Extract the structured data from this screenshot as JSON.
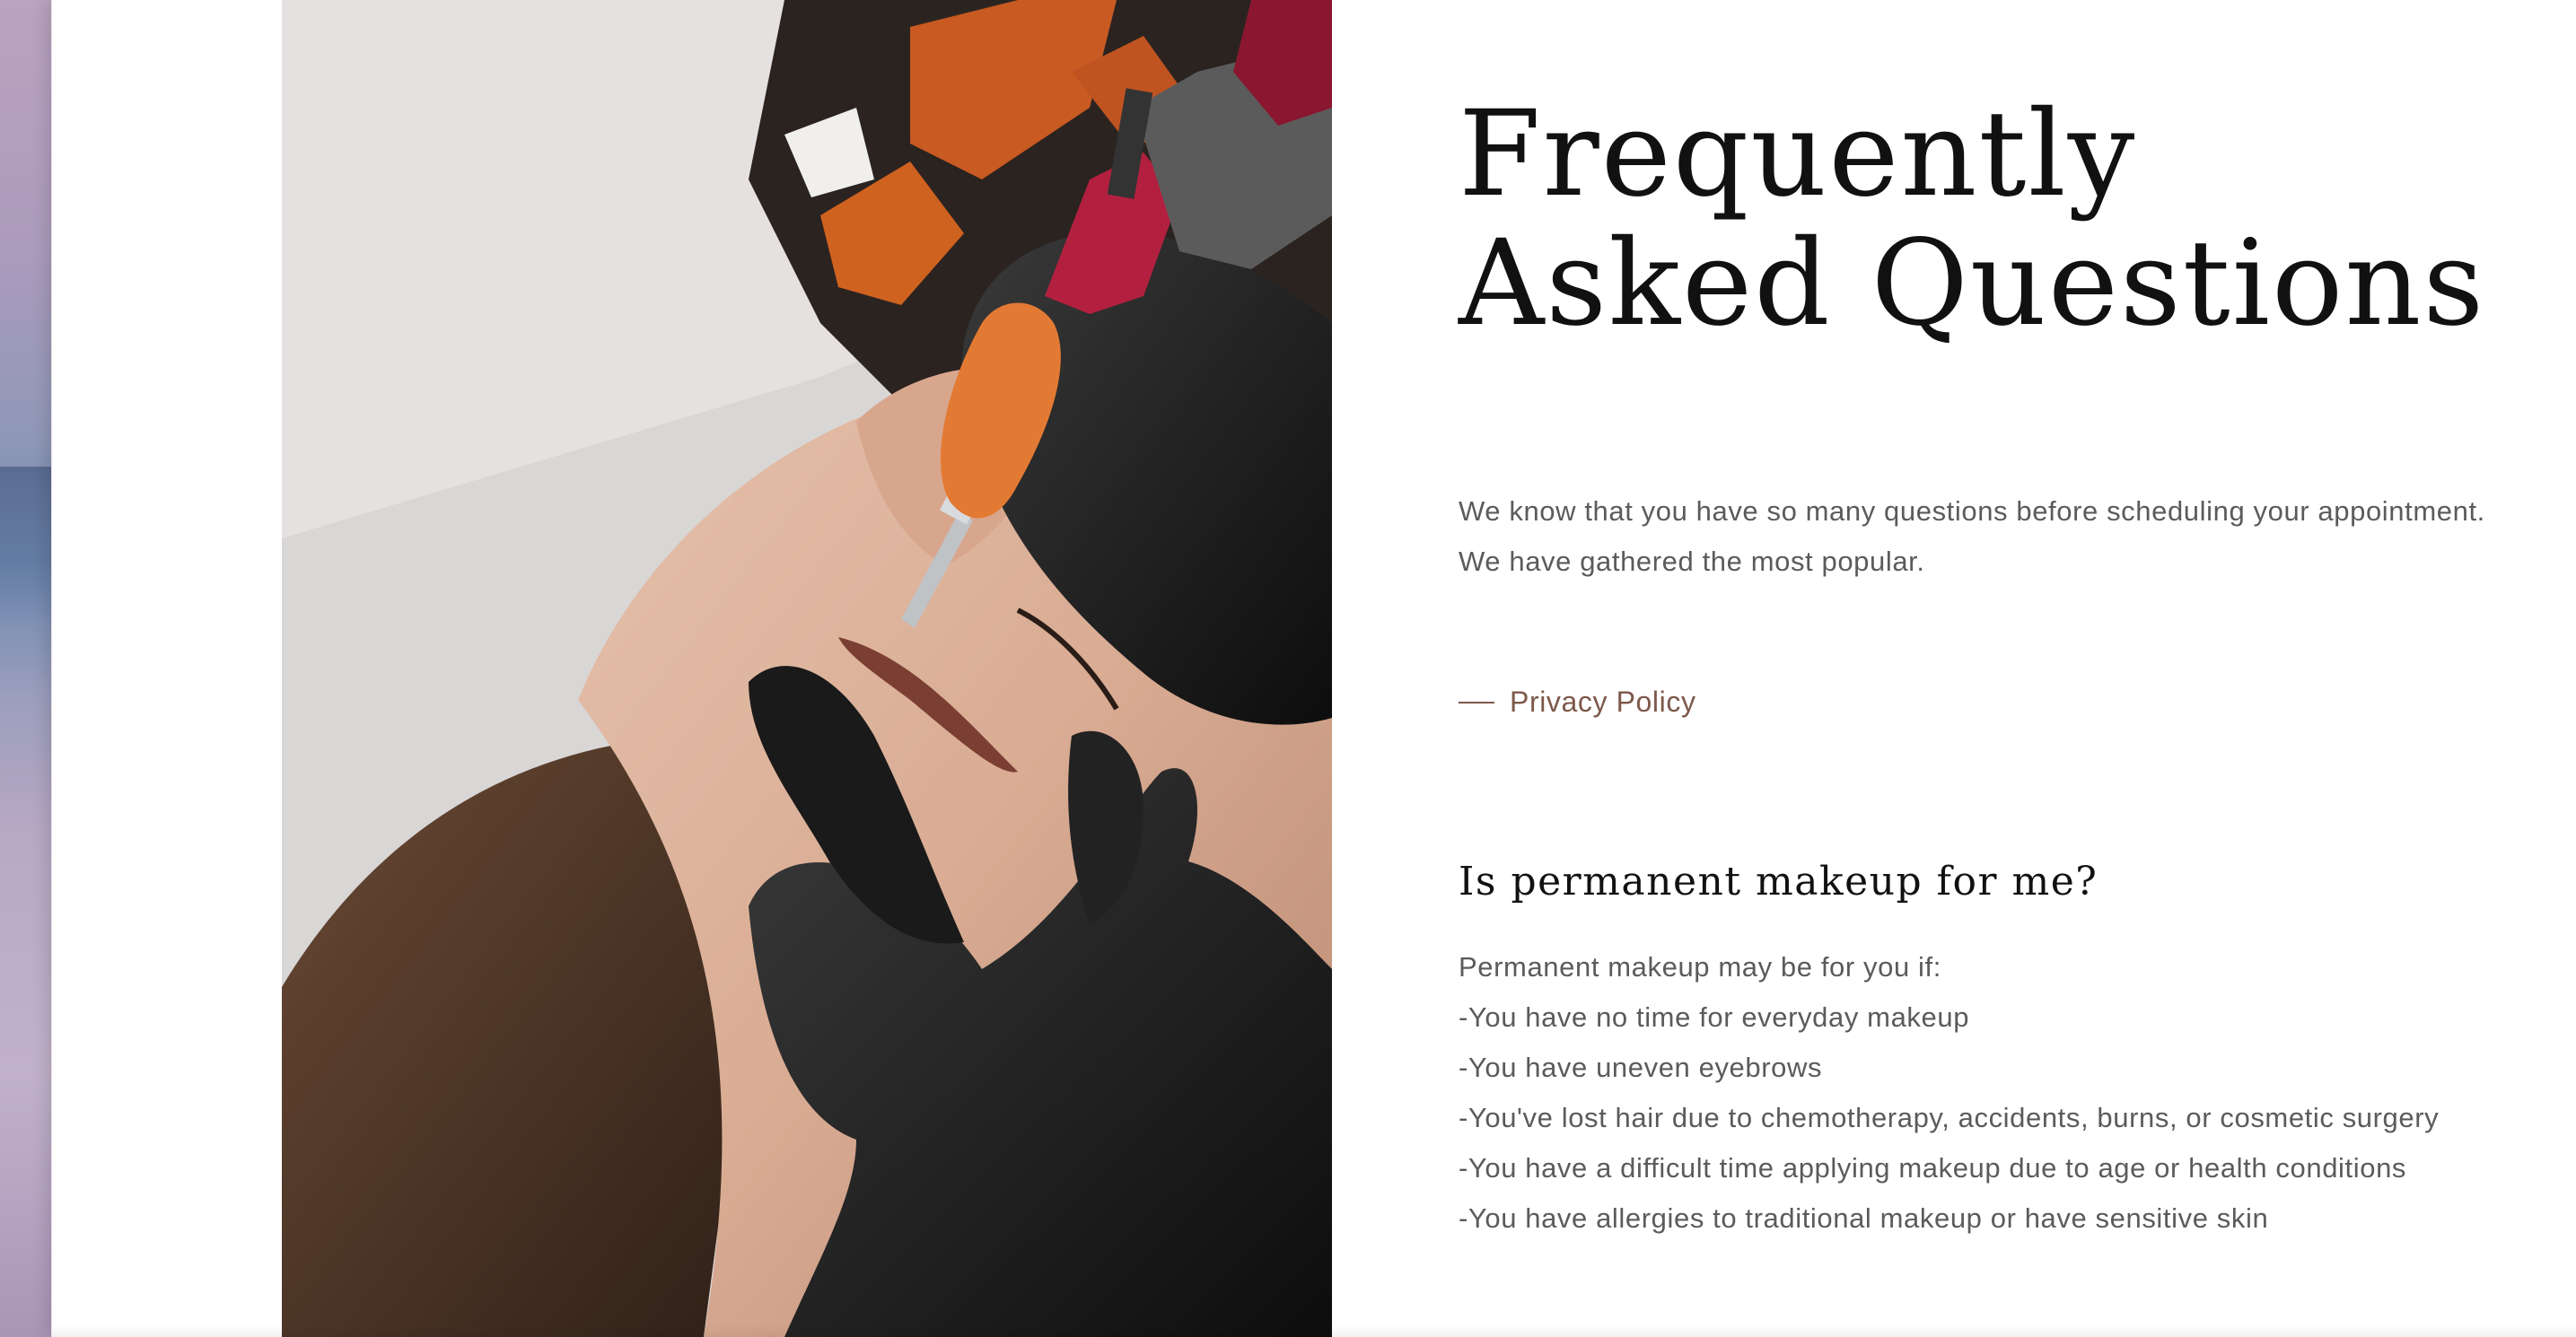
{
  "faq": {
    "title_line1": "Frequently",
    "title_line2": "Asked Questions",
    "intro": "We know that you have so many questions before scheduling your appointment. We have gathered the most popular.",
    "privacy_link": "Privacy Policy",
    "items": [
      {
        "question": "Is permanent makeup for me?",
        "answer_lines": [
          "Permanent makeup may be for you if:",
          "-You have no time for everyday makeup",
          "-You have uneven eyebrows",
          "-You've lost hair due to chemotherapy, accidents, burns, or cosmetic surgery",
          "-You have a difficult time applying makeup due to age or health conditions",
          "-You have allergies to traditional makeup or have sensitive skin"
        ]
      }
    ]
  },
  "image": {
    "subject": "permanent-makeup-eyebrow-procedure-photo"
  },
  "colors": {
    "accent": "#7d584a",
    "heading": "#111111",
    "body_text": "#5b5b5b",
    "glove": "#1d1d1d",
    "tattoo_grip": "#e37a33",
    "tattoo_machine": "#b3203f"
  }
}
